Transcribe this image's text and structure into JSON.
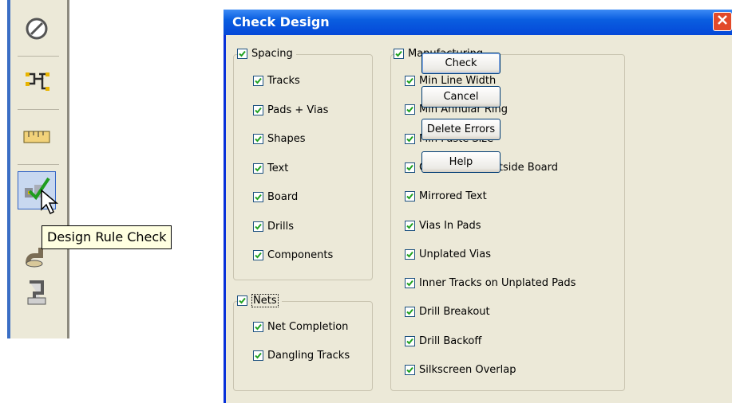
{
  "toolbar": {
    "icons": [
      "no-entry-icon",
      "net-icon",
      "ruler-icon",
      "design-rule-check-icon",
      "wire-icon",
      "plug-icon"
    ],
    "tooltip": "Design Rule Check"
  },
  "dialog": {
    "title": "Check Design",
    "spacing": {
      "label": "Spacing",
      "checked": true,
      "items": [
        {
          "label": "Tracks",
          "checked": true
        },
        {
          "label": "Pads + Vias",
          "checked": true
        },
        {
          "label": "Shapes",
          "checked": true
        },
        {
          "label": "Text",
          "checked": true
        },
        {
          "label": "Board",
          "checked": true
        },
        {
          "label": "Drills",
          "checked": true
        },
        {
          "label": "Components",
          "checked": true
        }
      ]
    },
    "nets": {
      "label": "Nets",
      "checked": true,
      "items": [
        {
          "label": "Net Completion",
          "checked": true
        },
        {
          "label": "Dangling Tracks",
          "checked": true
        }
      ]
    },
    "manufacturing": {
      "label": "Manufacturing",
      "checked": true,
      "items": [
        {
          "label": "Min Line Width",
          "checked": true
        },
        {
          "label": "Min Annular Ring",
          "checked": true
        },
        {
          "label": "Min Paste Size",
          "checked": true
        },
        {
          "label": "Copper Text Outside Board",
          "checked": true
        },
        {
          "label": "Mirrored Text",
          "checked": true
        },
        {
          "label": "Vias In Pads",
          "checked": true
        },
        {
          "label": "Unplated Vias",
          "checked": true
        },
        {
          "label": "Inner Tracks on Unplated Pads",
          "checked": true
        },
        {
          "label": "Drill Breakout",
          "checked": true
        },
        {
          "label": "Drill Backoff",
          "checked": true
        },
        {
          "label": "Silkscreen Overlap",
          "checked": true
        }
      ]
    },
    "buttons": {
      "check": "Check",
      "cancel": "Cancel",
      "delete_errors": "Delete Errors",
      "help": "Help"
    }
  },
  "colors": {
    "titlebar": "#0a5ee0",
    "dialog_bg": "#ece9d8",
    "checkmark": "#21a121",
    "close": "#e24a2a",
    "tooltip_bg": "#ffffe1"
  }
}
